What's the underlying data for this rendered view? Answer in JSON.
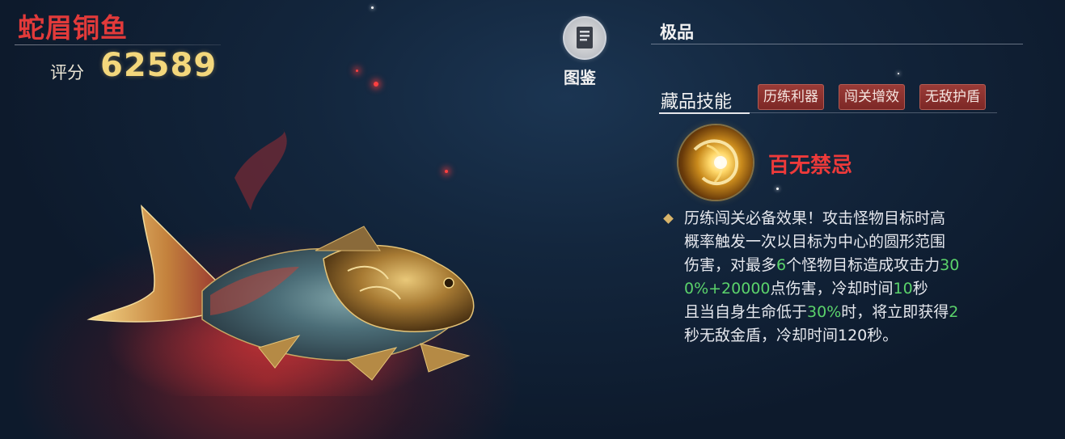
{
  "item": {
    "name": "蛇眉铜鱼",
    "score_label": "评分",
    "score": "62589",
    "grade": "极品"
  },
  "codex": {
    "label": "图鉴",
    "icon": "book-icon"
  },
  "skills": {
    "tab_label": "藏品技能",
    "tags": [
      "历练利器",
      "闯关增效",
      "无敌护盾"
    ],
    "skill": {
      "name": "百无禁忌",
      "icon": "golden-burst-icon",
      "description_lines": [
        [
          {
            "t": "历练闯关必备效果！攻击怪物目标时高"
          }
        ],
        [
          {
            "t": "概率触发一次以目标为中心的圆形范围"
          }
        ],
        [
          {
            "t": "伤害，对最多"
          },
          {
            "t": "6",
            "hl": true
          },
          {
            "t": "个怪物目标造成攻击力"
          },
          {
            "t": "30",
            "hl": true
          }
        ],
        [
          {
            "t": "0%+20000",
            "hl": true
          },
          {
            "t": "点伤害，冷却时间"
          },
          {
            "t": "10",
            "hl": true
          },
          {
            "t": "秒"
          }
        ],
        [
          {
            "t": "且当自身生命低于"
          },
          {
            "t": "30%",
            "hl": true
          },
          {
            "t": "时，将立即获得"
          },
          {
            "t": "2",
            "hl": true
          }
        ],
        [
          {
            "t": "秒无敌金盾，冷却时间120秒。"
          }
        ]
      ]
    }
  },
  "colors": {
    "title": "#e23a3a",
    "score": "#f3d77c",
    "highlight": "#5bd36b",
    "tag_bg": "#8a302d",
    "skill_name": "#ee3a3a"
  }
}
